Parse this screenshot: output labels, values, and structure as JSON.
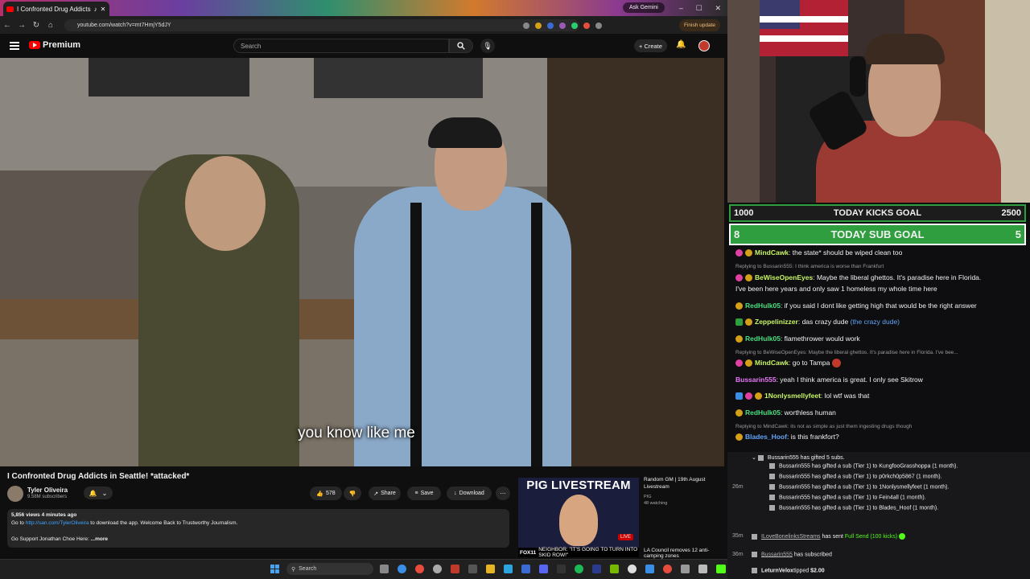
{
  "browser": {
    "tab_title": "I Confronted Drug Addicts",
    "ask_gemini": "Ask Gemini",
    "url": "youtube.com/watch?v=mt7HmjY5dJY",
    "finish_update": "Finish update"
  },
  "youtube": {
    "brand": "Premium",
    "search_placeholder": "Search",
    "create_label": "+ Create",
    "subtitle": "you know like me",
    "video_title": "I Confronted Drug Addicts in Seattle! *attacked*",
    "channel_name": "Tyler Oliveira",
    "channel_subs": "9.58M subscribers",
    "likes": "578",
    "share_label": "Share",
    "save_label": "Save",
    "download_label": "Download",
    "desc_meta": "5,856 views  4 minutes ago",
    "desc_line1_pre": "Go to ",
    "desc_line1_link": "http://san.com/TylerOliveira",
    "desc_line1_post": " to download the app. Welcome Back to Trustworthy Journalism.",
    "desc_line2": "Go Support Jonathan Choe Here:",
    "desc_more": "...more",
    "rec_banner": "PIG LIVESTREAM",
    "rec_live": "LIVE",
    "rec_news": "NEIGHBOR: \"IT'S GOING TO TURN INTO SKID ROW!\"",
    "rec_news_station": "FOX11",
    "rec_title": "Random GM | 19th August Livestream",
    "rec_channel": "PIG",
    "rec_watching": "48 watching",
    "rec2_title": "LA Council removes 12 anti-camping zones"
  },
  "taskbar": {
    "search_label": "Search"
  },
  "goals": {
    "kicks": {
      "left": "1000",
      "label": "TODAY KICKS GOAL",
      "right": "2500"
    },
    "subs": {
      "left": "8",
      "label": "TODAY SUB GOAL",
      "right": "5"
    }
  },
  "chat": {
    "m1": {
      "user": "MindCawk",
      "text": ": the state* should be wiped clean too",
      "color": "#c7f464"
    },
    "r1": "Replying to Bussarin555: I think america is worse than Frankfurt",
    "m2": {
      "user": "BeWiseOpenEyes",
      "text": ": Maybe the liberal ghettos. It's paradise here in Florida.",
      "cont": "I've been here years and only saw 1 homeless my whole time here",
      "color": "#c7f464"
    },
    "m3": {
      "user": "RedHulk05",
      "text": ": if you said I dont like getting high that would be the right answer",
      "color": "#4ade80"
    },
    "m4": {
      "user": "Zeppelinizzer",
      "text": ": das crazy dude ",
      "extra": "(the crazy dude)",
      "color": "#c7f464"
    },
    "m5": {
      "user": "RedHulk05",
      "text": ": flamethrower would work",
      "color": "#4ade80"
    },
    "r2": "Replying to BeWiseOpenEyes: Maybe the liberal ghettos. It's paradise here in Florida. I've bee...",
    "m6": {
      "user": "MindCawk",
      "text": ": go to Tampa",
      "color": "#c7f464"
    },
    "m7": {
      "user": "Bussarin555",
      "text": ": yeah I think america is great. I only see Skitrow",
      "color": "#e879f9"
    },
    "m8": {
      "user": "1Nonlysmellyfeet",
      "text": ": lol wtf was that",
      "color": "#c7f464"
    },
    "m9": {
      "user": "RedHulk05",
      "text": ": worthless human",
      "color": "#4ade80"
    },
    "r3": "Replying to MindCawk: its not as simple as just them ingesting drugs though",
    "m10": {
      "user": "Blades_Hoof",
      "text": ": is this frankfort?",
      "color": "#60a5fa"
    }
  },
  "events": {
    "gifted_header": "Bussarin555 has gifted 5 subs.",
    "gifts": [
      "Bussarin555 has gifted a sub (Tier 1) to KungfooGrasshoppa (1 month).",
      "Bussarin555 has gifted a sub (Tier 1) to p0rkch0p5867 (1 month).",
      "Bussarin555 has gifted a sub (Tier 1) to 1Nonlysmellyfeet (1 month).",
      "Bussarin555 has gifted a sub (Tier 1) to Fein4all (1 month).",
      "Bussarin555 has gifted a sub (Tier 1) to Blades_Hoof (1 month)."
    ],
    "t1": "26m",
    "t2": "35m",
    "e2_user": "ILoveBonelinksStreams",
    "e2_text": " has sent ",
    "e2_kicks": "Full Send (100 kicks)",
    "t3": "36m",
    "e3_user": "Bussarin555",
    "e3_text": " has subscribed",
    "e4_user": "LeturnVelox",
    "e4_text": "tipped ",
    "e4_amount": "$2.00"
  },
  "colors": {
    "accent_green": "#2e9e3e",
    "youtube_red": "#ff0000",
    "link_blue": "#3ea6ff"
  }
}
